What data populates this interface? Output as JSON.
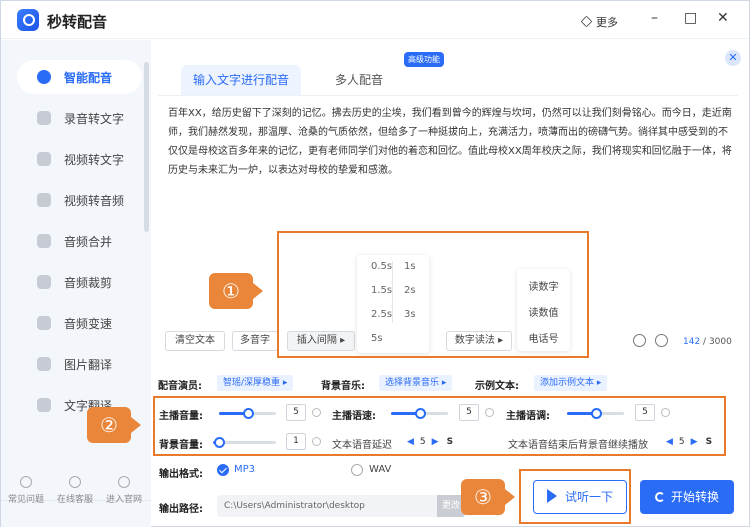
{
  "app": {
    "title": "秒转配音",
    "more_label": "更多"
  },
  "sidebar": {
    "items": [
      {
        "label": "智能配音",
        "active": true
      },
      {
        "label": "录音转文字"
      },
      {
        "label": "视频转文字"
      },
      {
        "label": "视频转音频"
      },
      {
        "label": "音频合并"
      },
      {
        "label": "音频裁剪"
      },
      {
        "label": "音频变速"
      },
      {
        "label": "图片翻译"
      },
      {
        "label": "文字翻译"
      }
    ],
    "footer": [
      {
        "label": "常见问题"
      },
      {
        "label": "在线客服"
      },
      {
        "label": "进入官网"
      }
    ]
  },
  "tabs": [
    {
      "label": "输入文字进行配音",
      "active": true
    },
    {
      "label": "多人配音"
    }
  ],
  "badge": "高级功能",
  "editor": {
    "text": "百年XX，给历史留下了深刻的记忆。拂去历史的尘埃，我们看到曾今的辉煌与坎坷，仍然可以让我们刻骨铭心。而今日，走近南师，我们赫然发现，那温厚、沧桑的气质依然，但给多了一种挺拔向上，充满活力，喷薄而出的磅礴气势。徜徉其中感受到的不仅仅是母校这百多年来的记忆，更有老师同学们对他的着恋和回忆。值此母校XX周年校庆之际，我们将现实和回忆融于一体，将历史与未来汇为一炉，以表达对母校的挚爱和感激。",
    "toolbar": {
      "clear": "清空文本",
      "polyphone": "多音字",
      "insert_pause": "插入间隔 ▸",
      "number_read": "数字读法 ▸"
    },
    "pause_options": [
      "0.5s",
      "1s",
      "1.5s",
      "2s",
      "2.5s",
      "3s",
      "5s"
    ],
    "read_options": [
      "读数字",
      "读数值",
      "电话号"
    ],
    "count_current": "142",
    "count_total": " / 3000"
  },
  "markers": [
    "①",
    "②",
    "③"
  ],
  "settings": {
    "voice_label": "配音演员:",
    "voice_value": "智瑶/深厚稳重 ▸",
    "bgm_label": "背景音乐:",
    "bgm_value": "选择背景音乐 ▸",
    "sample_label": "示例文本:",
    "sample_value": "添加示例文本 ▸",
    "main_volume_label": "主播音量:",
    "main_volume": "5",
    "main_volume_fraction": 0.5,
    "speed_label": "主播语速:",
    "speed": "5",
    "speed_fraction": 0.5,
    "pitch_label": "主播语调:",
    "pitch": "5",
    "pitch_fraction": 0.5,
    "bg_volume_label": "背景音量:",
    "bg_volume": "1",
    "bg_volume_fraction": 0.1,
    "delay_label": "文本语音延迟",
    "delay_value": "5",
    "delay_unit": "S",
    "tail_label": "文本语音结束后背景音继续播放",
    "tail_value": "5",
    "tail_unit": "S"
  },
  "output": {
    "format_label": "输出格式:",
    "mp3": "MP3",
    "wav": "WAV",
    "path_label": "输出路径:",
    "path_value": "C:\\Users\\Administrator\\desktop",
    "path_button": "更改"
  },
  "buttons": {
    "listen": "试听一下",
    "start": "开始转换"
  },
  "colors": {
    "accent": "#2a6cf6",
    "highlight": "#e97a2c"
  }
}
